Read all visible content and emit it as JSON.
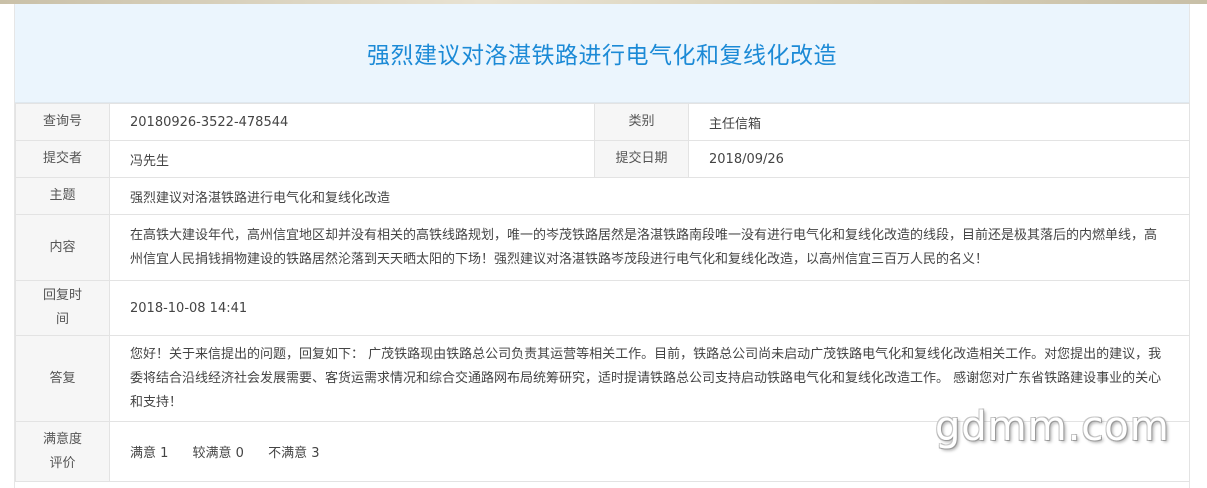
{
  "title": "强烈建议对洛湛铁路进行电气化和复线化改造",
  "rows": {
    "query_no": {
      "label": "查询号",
      "value": "20180926-3522-478544"
    },
    "category": {
      "label": "类别",
      "value": "主任信箱"
    },
    "submitter": {
      "label": "提交者",
      "value": "冯先生"
    },
    "submit_date": {
      "label": "提交日期",
      "value": "2018/09/26"
    },
    "subject": {
      "label": "主题",
      "value": "强烈建议对洛湛铁路进行电气化和复线化改造"
    },
    "content": {
      "label": "内容",
      "value": "在高铁大建设年代，高州信宜地区却并没有相关的高铁线路规划，唯一的岑茂铁路居然是洛湛铁路南段唯一没有进行电气化和复线化改造的线段，目前还是极其落后的内燃单线，高州信宜人民捐钱捐物建设的铁路居然沦落到天天晒太阳的下场！强烈建议对洛湛铁路岑茂段进行电气化和复线化改造，以高州信宜三百万人民的名义！"
    },
    "reply_time": {
      "label_line1": "回复时",
      "label_line2": "间",
      "value": "2018-10-08 14:41"
    },
    "reply": {
      "label": "答复",
      "value": "您好！关于来信提出的问题，回复如下： 广茂铁路现由铁路总公司负责其运营等相关工作。目前，铁路总公司尚未启动广茂铁路电气化和复线化改造相关工作。对您提出的建议，我委将结合沿线经济社会发展需要、客货运需求情况和综合交通路网布局统筹研究，适时提请铁路总公司支持启动铁路电气化和复线化改造工作。 感谢您对广东省铁路建设事业的关心和支持！"
    },
    "satisfaction": {
      "label_line1": "满意度",
      "label_line2": "评价",
      "satisfied": "满意 1",
      "fairly_satisfied": "较满意 0",
      "unsatisfied": "不满意 3"
    }
  },
  "watermark": "gdmm.com",
  "colors": {
    "title": "#1c8ad6",
    "title_bg": "#ebf5fd",
    "label_bg": "#f6f6f6",
    "border": "#e3e3e3"
  }
}
